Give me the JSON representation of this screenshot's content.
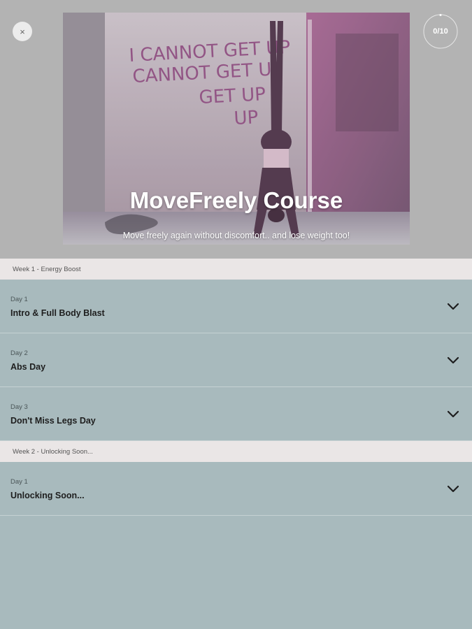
{
  "header": {
    "close_icon_glyph": "×",
    "progress_text": "0/10",
    "progress_fraction": 0.0,
    "title": "MoveFreely Course",
    "subtitle": "Move freely again without discomfort.. and lose weight too!",
    "hero_graffiti_lines": [
      "I CANNOT GET UP",
      "CANNOT GET UP",
      "GET UP",
      "UP"
    ]
  },
  "weeks": [
    {
      "label": "Week 1 - Energy Boost",
      "days": [
        {
          "label": "Day 1",
          "title": "Intro & Full Body Blast"
        },
        {
          "label": "Day 2",
          "title": "Abs Day"
        },
        {
          "label": "Day 3",
          "title": "Don't Miss Legs Day"
        }
      ]
    },
    {
      "label": "Week 2 - Unlocking Soon...",
      "days": [
        {
          "label": "Day 1",
          "title": "Unlocking Soon..."
        }
      ]
    }
  ],
  "colors": {
    "header_bg": "#b3b3b3",
    "list_bg": "#a8babd",
    "week_header_bg": "#eae6e6"
  }
}
